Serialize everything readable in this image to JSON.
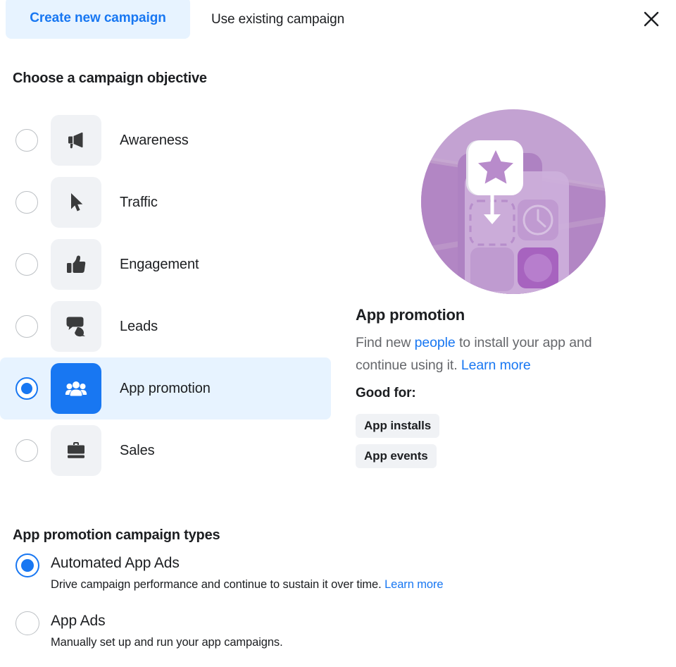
{
  "tabs": {
    "active_label": "Create new campaign",
    "inactive_label": "Use existing campaign",
    "close_icon": "close-icon"
  },
  "objective_section": {
    "heading": "Choose a campaign objective",
    "items": [
      {
        "label": "Awareness",
        "icon": "megaphone-icon",
        "selected": false
      },
      {
        "label": "Traffic",
        "icon": "cursor-icon",
        "selected": false
      },
      {
        "label": "Engagement",
        "icon": "thumbs-up-icon",
        "selected": false
      },
      {
        "label": "Leads",
        "icon": "chat-bubbles-icon",
        "selected": false
      },
      {
        "label": "App promotion",
        "icon": "people-group-icon",
        "selected": true
      },
      {
        "label": "Sales",
        "icon": "shopping-bag-icon",
        "selected": false
      }
    ]
  },
  "detail": {
    "illustration": "app-promotion-illustration",
    "title": "App promotion",
    "description_part1": "Find new ",
    "description_link1": "people",
    "description_part2": " to install your app and continue using it. ",
    "description_link2": "Learn more",
    "good_for_label": "Good for:",
    "tags": [
      "App installs",
      "App events"
    ]
  },
  "campaign_types": {
    "heading": "App promotion campaign types",
    "items": [
      {
        "title": "Automated App Ads",
        "description": "Drive campaign performance and continue to sustain it over time. ",
        "link": "Learn more",
        "selected": true
      },
      {
        "title": "App Ads",
        "description": "Manually set up and run your app campaigns.",
        "link": "",
        "selected": false
      }
    ]
  },
  "colors": {
    "accent_blue": "#1877f2",
    "selected_row_bg": "#e7f3ff",
    "tile_bg": "#f0f2f5",
    "text_primary": "#1c1e21",
    "text_secondary": "#65676b",
    "illustration_purple": "#b58fc4"
  }
}
